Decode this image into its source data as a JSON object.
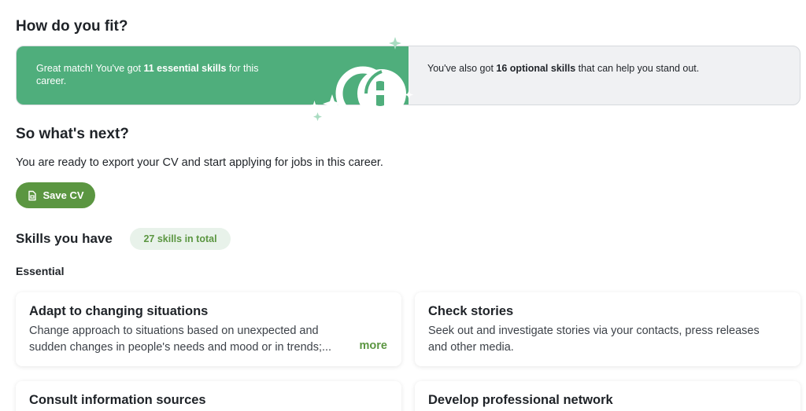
{
  "fit": {
    "title": "How do you fit?",
    "essential_prefix": "Great match! You've got ",
    "essential_bold": "11 essential skills",
    "essential_suffix": " for this career.",
    "optional_prefix": "You've also got ",
    "optional_bold": "16 optional skills",
    "optional_suffix": " that can help you stand out.",
    "colors": {
      "match_green": "#4fae7c",
      "panel_gray": "#f0f1f3"
    }
  },
  "next": {
    "title": "So what's next?",
    "description": "You are ready to export your CV and start applying for jobs in this career.",
    "save_button": "Save CV",
    "save_icon": "document-icon",
    "button_color": "#5b9641"
  },
  "skills": {
    "title": "Skills you have",
    "badge": "27 skills in total",
    "essential_label": "Essential",
    "cards": [
      {
        "title": "Adapt to changing situations",
        "line1": "Change approach to situations based on unexpected and",
        "line2": "sudden changes in people's needs and mood or in trends;...",
        "more": "more"
      },
      {
        "title": "Check stories",
        "line1": "Seek out and investigate stories via your contacts, press releases",
        "line2": "and other media."
      },
      {
        "title": "Consult information sources"
      },
      {
        "title": "Develop professional network"
      }
    ]
  }
}
